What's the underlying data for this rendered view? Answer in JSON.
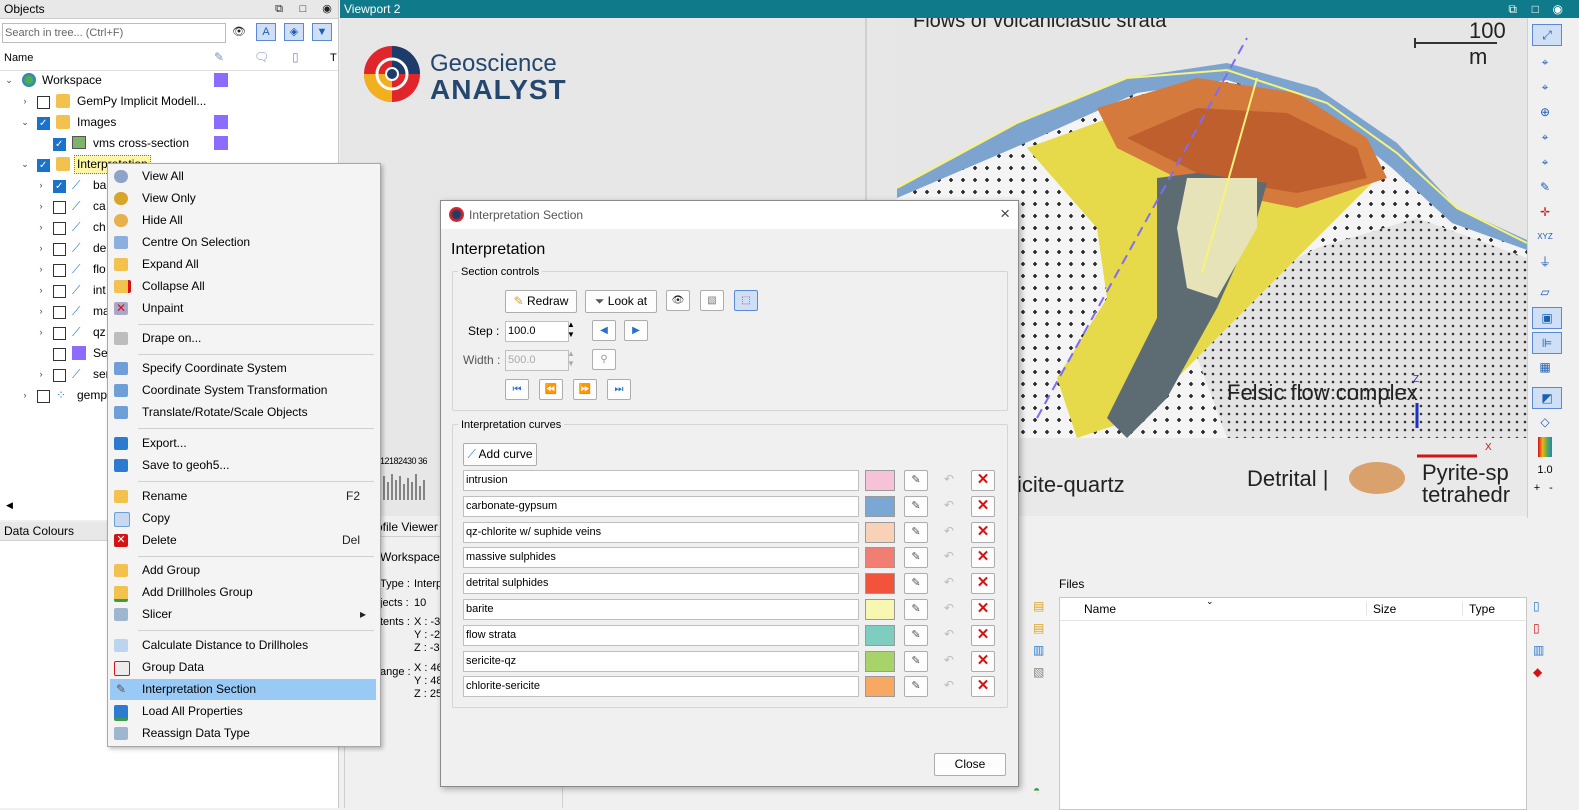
{
  "objects_panel": {
    "title": "Objects",
    "search_placeholder": "Search in tree... (Ctrl+F)",
    "columns": [
      "Name",
      "T"
    ],
    "tree": [
      {
        "label": "Workspace",
        "indent": 0
      },
      {
        "label": "GemPy Implicit Modell...",
        "indent": 1
      },
      {
        "label": "Images",
        "indent": 1
      },
      {
        "label": "vms cross-section",
        "indent": 2
      },
      {
        "label": "Interpretation",
        "indent": 1
      },
      {
        "label": "ba",
        "indent": 2
      },
      {
        "label": "ca",
        "indent": 2
      },
      {
        "label": "ch",
        "indent": 2
      },
      {
        "label": "de",
        "indent": 2
      },
      {
        "label": "flo",
        "indent": 2
      },
      {
        "label": "int",
        "indent": 2
      },
      {
        "label": "ma",
        "indent": 2
      },
      {
        "label": "qz",
        "indent": 2
      },
      {
        "label": "Se",
        "indent": 2
      },
      {
        "label": "ser",
        "indent": 2
      },
      {
        "label": "gemp",
        "indent": 1
      }
    ]
  },
  "data_colours": {
    "title": "Data Colours"
  },
  "context_menu": {
    "items": [
      {
        "label": "View All",
        "shortcut": ""
      },
      {
        "label": "View Only",
        "shortcut": ""
      },
      {
        "label": "Hide All",
        "shortcut": ""
      },
      {
        "label": "Centre On Selection",
        "shortcut": ""
      },
      {
        "label": "Expand All",
        "shortcut": ""
      },
      {
        "label": "Collapse All",
        "shortcut": ""
      },
      {
        "label": "Unpaint",
        "shortcut": ""
      },
      {
        "label": "Drape on...",
        "shortcut": ""
      },
      {
        "label": "Specify Coordinate System",
        "shortcut": ""
      },
      {
        "label": "Coordinate System Transformation",
        "shortcut": ""
      },
      {
        "label": "Translate/Rotate/Scale Objects",
        "shortcut": ""
      },
      {
        "label": "Export...",
        "shortcut": ""
      },
      {
        "label": "Save to geoh5...",
        "shortcut": ""
      },
      {
        "label": "Rename",
        "shortcut": "F2"
      },
      {
        "label": "Copy",
        "shortcut": ""
      },
      {
        "label": "Delete",
        "shortcut": "Del"
      },
      {
        "label": "Add Group",
        "shortcut": ""
      },
      {
        "label": "Add Drillholes Group",
        "shortcut": ""
      },
      {
        "label": "Slicer",
        "shortcut": "▸"
      },
      {
        "label": "Calculate Distance to Drillholes",
        "shortcut": ""
      },
      {
        "label": "Group Data",
        "shortcut": ""
      },
      {
        "label": "Interpretation Section",
        "shortcut": ""
      },
      {
        "label": "Load All Properties",
        "shortcut": ""
      },
      {
        "label": "Reassign Data Type",
        "shortcut": ""
      }
    ]
  },
  "viewport": {
    "title": "Viewport 2",
    "logo_top": "Geoscience",
    "logo_bottom": "ANALYST",
    "image_texts": {
      "top": "Flows of volcaniclastic strata",
      "scale": "100 m",
      "felsic": "Felsic flow complex",
      "sericite": "icite-quartz",
      "detrital": "Detrital |",
      "pyrite1": "Pyrite-sp",
      "pyrite2": "tetrahedr"
    },
    "axis_z": "Z",
    "axis_x": "X",
    "toolbar_value": "1.0",
    "toolbar_xyz": "XYZ"
  },
  "profile": {
    "tab_label": "ofile Viewer",
    "workspace": "Workspace",
    "type_label": "Type :",
    "type_value": "Interp",
    "objects_label": "jects :",
    "objects_value": "10",
    "extents_label": "tents :",
    "ext_x": "X : -3",
    "ext_y": "Y : -2",
    "ext_z": "Z : -3",
    "range_label": "ange :",
    "rng_x": "X : 46",
    "rng_y": "Y : 48",
    "rng_z": "Z : 25",
    "ticks": "12182430 36"
  },
  "files_panel": {
    "title": "Files",
    "col_name": "Name",
    "col_size": "Size",
    "col_type": "Type"
  },
  "dialog": {
    "title": "Interpretation Section",
    "heading": "Interpretation",
    "section_controls": "Section controls",
    "redraw": "Redraw",
    "look_at": "Look at",
    "step_label": "Step :",
    "step_value": "100.0",
    "width_label": "Width :",
    "width_value": "500.0",
    "curves_title": "Interpretation curves",
    "add_curve": "Add curve",
    "close": "Close",
    "curves": [
      {
        "name": "intrusion",
        "color": "#f6c2d8"
      },
      {
        "name": "carbonate-gypsum",
        "color": "#7aa7d4"
      },
      {
        "name": "qz-chlorite w/ suphide veins",
        "color": "#f7d2b7"
      },
      {
        "name": "massive sulphides",
        "color": "#f07e72"
      },
      {
        "name": "detrital sulphides",
        "color": "#f4533b"
      },
      {
        "name": "barite",
        "color": "#f8f7b1"
      },
      {
        "name": "flow strata",
        "color": "#7fcdc0"
      },
      {
        "name": "sericite-qz",
        "color": "#a7d36a"
      },
      {
        "name": "chlorite-sericite",
        "color": "#f7a862"
      }
    ]
  }
}
